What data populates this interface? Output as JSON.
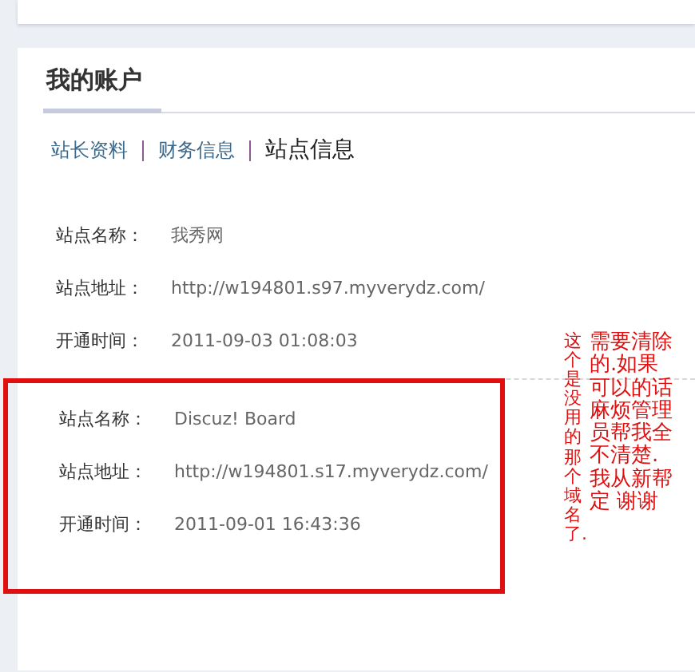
{
  "account": {
    "title": "我的账户",
    "tabs": [
      {
        "label": "站长资料",
        "selected": false
      },
      {
        "label": "财务信息",
        "selected": false
      },
      {
        "label": "站点信息",
        "selected": true
      }
    ],
    "sites": [
      {
        "highlighted": false,
        "fields": [
          {
            "label": "站点名称：",
            "value": "我秀网"
          },
          {
            "label": "站点地址：",
            "value": "http://w194801.s97.myverydz.com/"
          },
          {
            "label": "开通时间：",
            "value": "2011-09-03 01:08:03"
          }
        ]
      },
      {
        "highlighted": true,
        "fields": [
          {
            "label": "站点名称：",
            "value": "Discuz! Board"
          },
          {
            "label": "站点地址：",
            "value": "http://w194801.s17.myverydz.com/"
          },
          {
            "label": "开通时间：",
            "value": "2011-09-01 16:43:36"
          }
        ]
      }
    ]
  },
  "annotation": {
    "notes": [
      "这个是没用的那个域名了.",
      "需要清除的.如果可以的话麻烦管理员帮我全不清楚.我从新帮定 谢谢"
    ]
  }
}
